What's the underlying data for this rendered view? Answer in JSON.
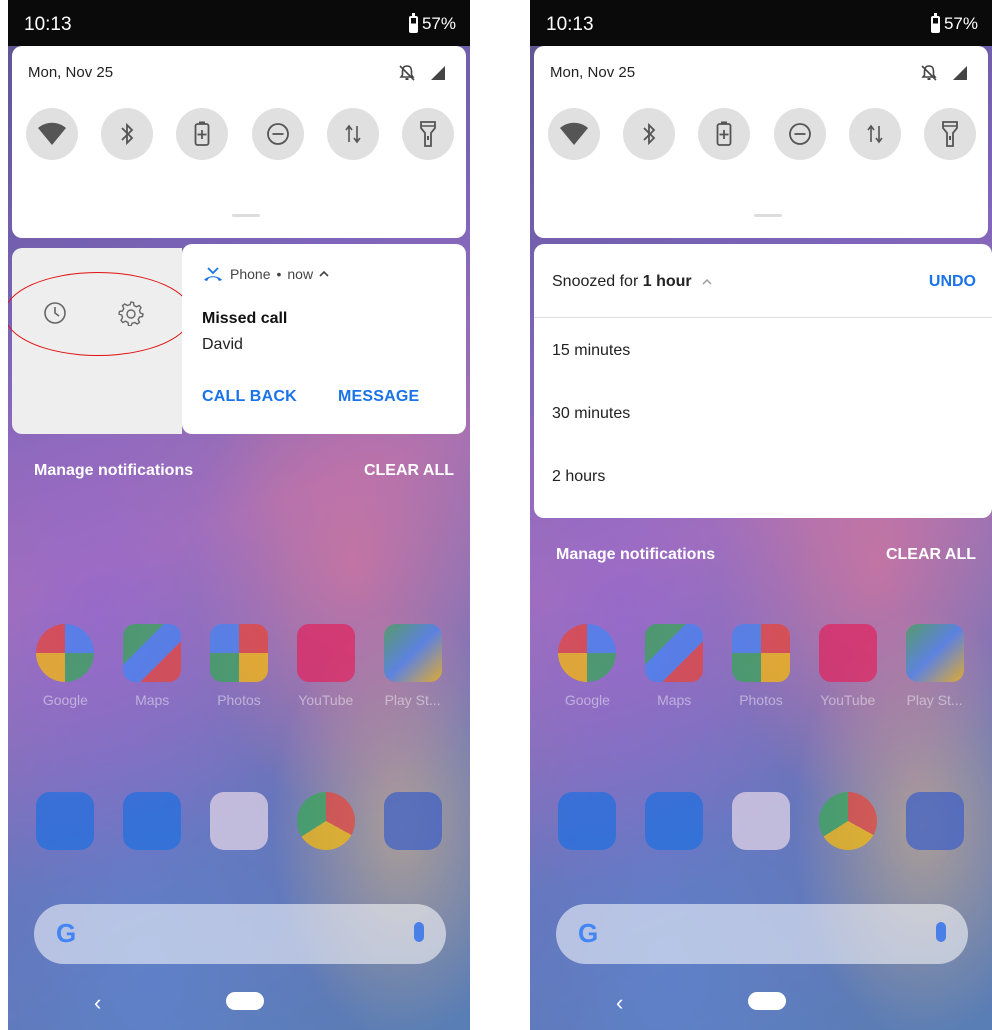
{
  "status": {
    "time": "10:13",
    "battery": "57%"
  },
  "quick_settings": {
    "date": "Mon, Nov 25",
    "tiles": [
      "wifi-icon",
      "bluetooth-icon",
      "battery-saver-icon",
      "do-not-disturb-icon",
      "mobile-data-icon",
      "flashlight-icon"
    ]
  },
  "notification": {
    "app": "Phone",
    "time": "now",
    "title": "Missed call",
    "caller": "David",
    "actions": [
      "CALL BACK",
      "MESSAGE"
    ]
  },
  "footer": {
    "manage": "Manage notifications",
    "clear": "CLEAR ALL"
  },
  "snooze": {
    "prefix": "Snoozed for",
    "duration": "1 hour",
    "undo": "UNDO",
    "options": [
      "15 minutes",
      "30 minutes",
      "2 hours"
    ]
  },
  "home_apps": [
    {
      "label": "Google"
    },
    {
      "label": "Maps"
    },
    {
      "label": "Photos"
    },
    {
      "label": "YouTube"
    },
    {
      "label": "Play St..."
    }
  ],
  "dock_apps": [
    "phone-icon",
    "messages-icon",
    "gmail-icon",
    "chrome-icon",
    "camera-icon"
  ],
  "colors": {
    "accent": "#1a73e8",
    "annotation": "#e01010"
  }
}
